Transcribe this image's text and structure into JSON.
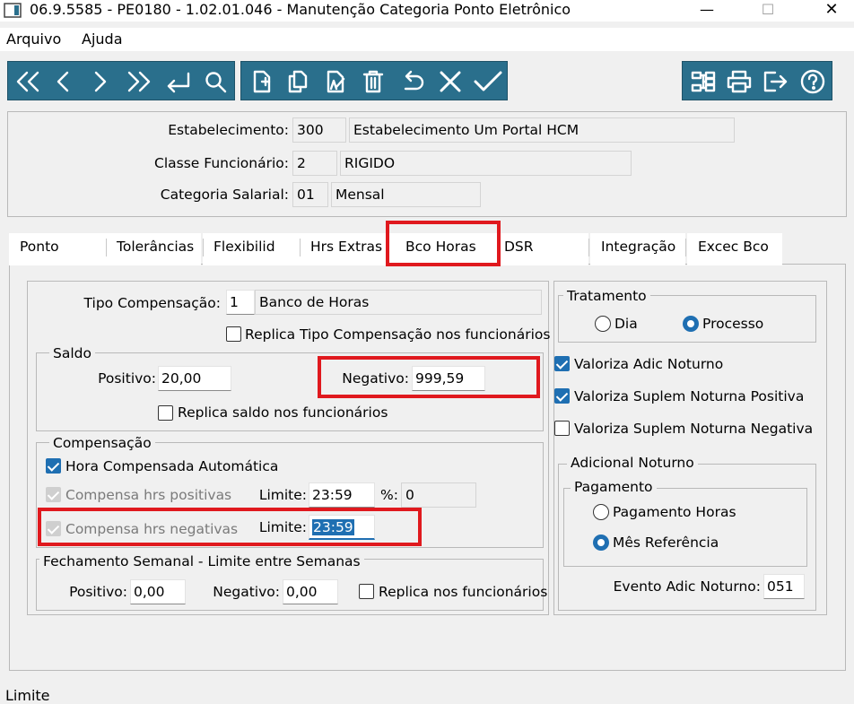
{
  "window": {
    "title": "06.9.5585 - PE0180 - 1.02.01.046 - Manutenção Categoria Ponto Eletrônico",
    "minimize": "—",
    "maximize": "☐",
    "close": "✕"
  },
  "menu": {
    "items": [
      "Arquivo",
      "Ajuda"
    ]
  },
  "toolbar": {
    "nav_icons": [
      "first-icon",
      "previous-icon",
      "next-icon",
      "last-icon",
      "goto-icon",
      "search-icon"
    ],
    "edit_icons": [
      "new-icon",
      "copy-icon",
      "edit-icon",
      "delete-icon",
      "undo-icon",
      "cancel-icon",
      "confirm-icon"
    ],
    "util_icons": [
      "zoom-icon",
      "print-icon",
      "exit-icon",
      "help-icon"
    ],
    "color": "#2a6f8c"
  },
  "header": {
    "estabelecimento": {
      "label": "Estabelecimento:",
      "code": "300",
      "name": "Estabelecimento Um Portal HCM"
    },
    "classe": {
      "label": "Classe Funcionário:",
      "code": "2",
      "name": "RIGIDO"
    },
    "categoria": {
      "label": "Categoria Salarial:",
      "code": "01",
      "name": "Mensal"
    }
  },
  "tabs": [
    "Ponto",
    "Tolerâncias",
    "Flexibilid",
    "Hrs Extras",
    "Bco Horas",
    "DSR",
    "Integração",
    "Excec Bco"
  ],
  "active_tab": "Bco Horas",
  "bco_horas": {
    "tipo_compensacao": {
      "label": "Tipo Compensação:",
      "code": "1",
      "name": "Banco de Horas"
    },
    "replica_tipo": {
      "label": "Replica Tipo Compensação nos funcionários",
      "checked": false
    },
    "saldo": {
      "title": "Saldo",
      "positivo_label": "Positivo:",
      "positivo": "20,00",
      "negativo_label": "Negativo:",
      "negativo": "999,59",
      "replica_label": "Replica saldo nos funcionários",
      "replica_checked": false
    },
    "compensacao": {
      "title": "Compensação",
      "hora_auto": {
        "label": "Hora Compensada Automática",
        "checked": true
      },
      "positivas": {
        "label": "Compensa hrs positivas",
        "limite_label": "Limite:",
        "limite": "23:59",
        "pct_label": "%:",
        "pct": "0"
      },
      "negativas": {
        "label": "Compensa hrs negativas",
        "limite_label": "Limite:",
        "limite": "23:59"
      }
    },
    "fechamento": {
      "title": "Fechamento Semanal - Limite entre Semanas",
      "positivo_label": "Positivo:",
      "positivo": "0,00",
      "negativo_label": "Negativo:",
      "negativo": "0,00",
      "replica_label": "Replica nos funcionários",
      "replica_checked": false
    },
    "tratamento": {
      "title": "Tratamento",
      "options": [
        "Dia",
        "Processo"
      ],
      "selected": "Processo"
    },
    "valoriza": [
      {
        "label": "Valoriza Adic Noturno",
        "checked": true
      },
      {
        "label": "Valoriza Suplem Noturna Positiva",
        "checked": true
      },
      {
        "label": "Valoriza Suplem Noturna Negativa",
        "checked": false
      }
    ],
    "adicional_noturno": {
      "title": "Adicional Noturno",
      "pagamento_title": "Pagamento",
      "options": [
        "Pagamento Horas",
        "Mês Referência"
      ],
      "selected": "Mês Referência",
      "evento_label": "Evento Adic Noturno:",
      "evento": "051"
    }
  },
  "status": {
    "text": "Limite"
  },
  "highlight_color": "#e0191e"
}
